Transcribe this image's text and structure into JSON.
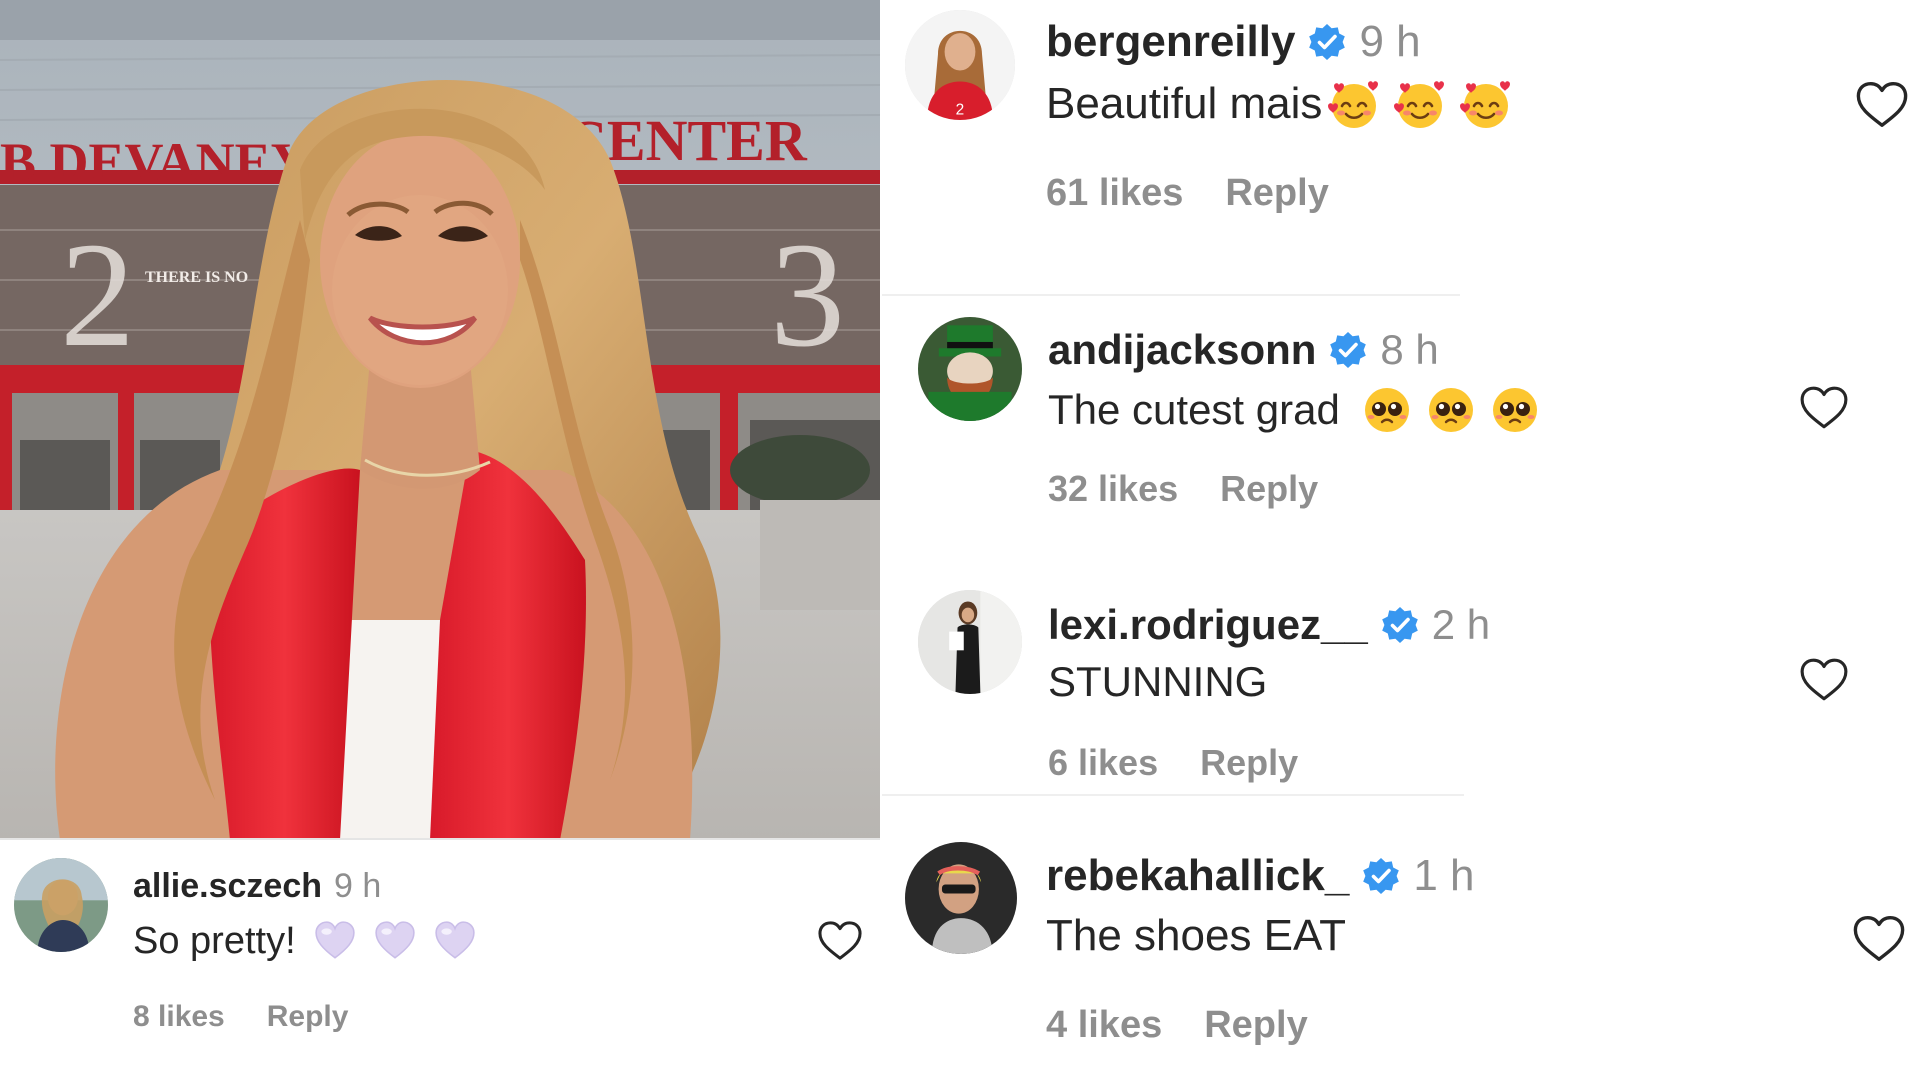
{
  "photo": {
    "sign_left": "B DEVANEY",
    "sign_right": "CENTER",
    "banner_text": "THERE IS NO",
    "banner_digit_left": "2",
    "banner_digit_right": "3"
  },
  "colors": {
    "verified": "#3897f0",
    "text_primary": "#262626",
    "text_secondary": "#8e8e8e"
  },
  "comments": [
    {
      "username": "allie.sczech",
      "verified": false,
      "time": "9 h",
      "text": "So pretty!",
      "emoji": [
        "light-purple-heart",
        "light-purple-heart",
        "light-purple-heart"
      ],
      "likes": "8 likes",
      "reply": "Reply"
    },
    {
      "username": "bergenreilly",
      "verified": true,
      "time": "9 h",
      "text": "Beautiful mais",
      "emoji": [
        "smiling-face-with-hearts",
        "smiling-face-with-hearts",
        "smiling-face-with-hearts"
      ],
      "likes": "61 likes",
      "reply": "Reply"
    },
    {
      "username": "andijacksonn",
      "verified": true,
      "time": "8 h",
      "text": "The cutest grad",
      "emoji": [
        "pleading-face",
        "pleading-face",
        "pleading-face"
      ],
      "likes": "32 likes",
      "reply": "Reply"
    },
    {
      "username": "lexi.rodriguez__",
      "verified": true,
      "time": "2 h",
      "text": "STUNNING",
      "emoji": [],
      "likes": "6 likes",
      "reply": "Reply"
    },
    {
      "username": "rebekahallick_",
      "verified": true,
      "time": "1 h",
      "text": "The shoes EAT",
      "emoji": [],
      "likes": "4 likes",
      "reply": "Reply"
    }
  ]
}
